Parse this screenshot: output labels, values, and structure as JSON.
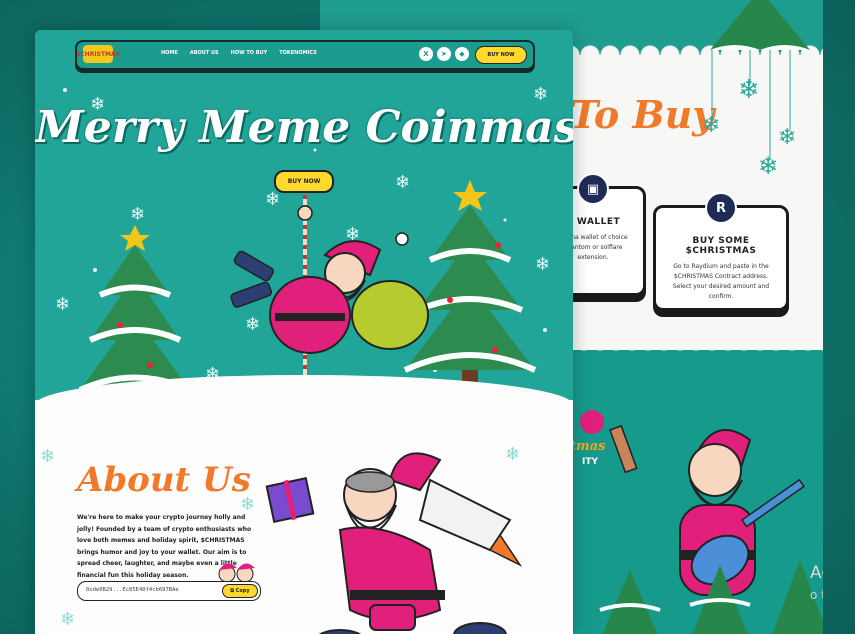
{
  "colors": {
    "teal": "#1fa396",
    "orange": "#f07a2a",
    "yellow": "#ffd92b",
    "santa_red": "#e0207a"
  },
  "nav": {
    "logo_text": "$CHRISTMAS",
    "links": [
      "HOME",
      "ABOUT US",
      "HOW TO BUY",
      "TOKENOMICS"
    ],
    "socials": [
      "X",
      "telegram-icon",
      "dex-icon"
    ],
    "buy_label": "BUY NOW"
  },
  "hero": {
    "headline": "Merry Meme Coinmas!",
    "buy_label": "BUY NOW"
  },
  "about": {
    "title": "About Us",
    "body": "We're here to make your crypto journey holly and jolly! Founded by a team of crypto enthusiasts who love both memes and holiday spirit, $CHRISTMAS brings humor and joy to your wallet. Our aim is to spread cheer, laughter, and maybe even a little financial fun this holiday season.",
    "contract": "0xde0B29...Ec85E40f4cb697BAe",
    "copy_label": "Copy"
  },
  "how_to_buy": {
    "title": "To Buy",
    "steps": [
      {
        "title": "A WALLET",
        "text": "Solana wallet of choice phantom or solflare extension."
      },
      {
        "title": "BUY SOME $CHRISTMAS",
        "text": "Go to Raydium and paste in the $CHRISTMAS Contract address. Select your desired amount and confirm."
      }
    ]
  },
  "community": {
    "label": "tmas\nITY"
  },
  "watermark": {
    "line1": "Activ",
    "line2": "o to"
  }
}
